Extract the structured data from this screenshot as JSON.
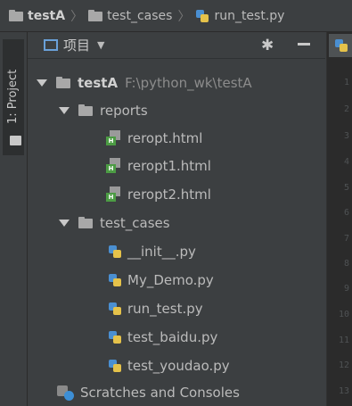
{
  "breadcrumb": {
    "items": [
      "testA",
      "test_cases",
      "run_test.py"
    ]
  },
  "strip": {
    "label": "1: Project"
  },
  "panel": {
    "title": "项目",
    "dropdown": "▼",
    "gear": "✱"
  },
  "tree": {
    "root": {
      "name": "testA",
      "path": "F:\\python_wk\\testA"
    },
    "reports": {
      "name": "reports",
      "files": [
        "reropt.html",
        "reropt1.html",
        "reropt2.html"
      ]
    },
    "test_cases": {
      "name": "test_cases",
      "files": [
        "__init__.py",
        "My_Demo.py",
        "run_test.py",
        "test_baidu.py",
        "test_youdao.py"
      ]
    },
    "scratches": "Scratches and Consoles"
  },
  "gutter": {
    "line_numbers": [
      "1",
      "2",
      "3",
      "4",
      "5",
      "6",
      "7",
      "8",
      "9",
      "10",
      "11",
      "12",
      "13"
    ]
  },
  "colors": {
    "background": "#3c3f41",
    "text": "#bbbbbb",
    "python_blue": "#4a8fd1",
    "python_yellow": "#e5c24a",
    "html_green": "#4c9c44"
  }
}
